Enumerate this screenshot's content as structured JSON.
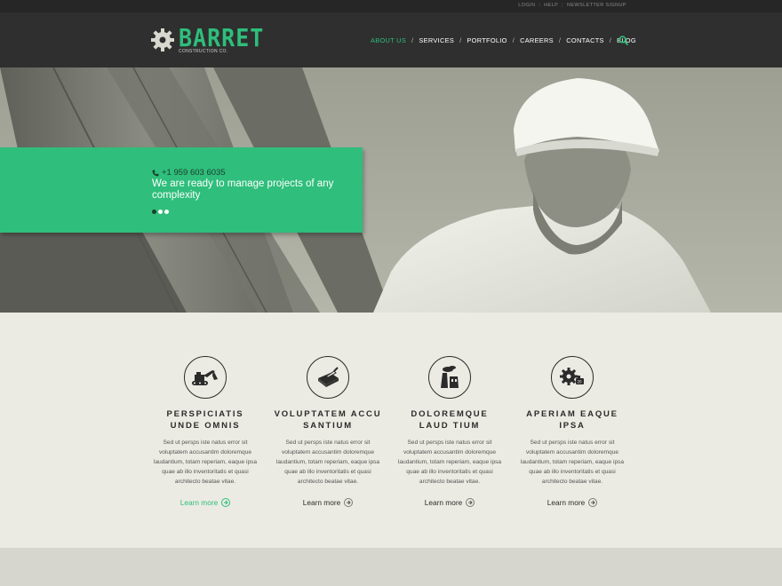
{
  "topbar": {
    "links": [
      "LOGIN",
      "HELP",
      "NEWSLETTER SIGNUP"
    ]
  },
  "logo": {
    "name": "BARRET",
    "subtitle": "CONSTRUCTION CO."
  },
  "nav": {
    "items": [
      "ABOUT US",
      "SERVICES",
      "PORTFOLIO",
      "CAREERS",
      "CONTACTS",
      "BLOG"
    ],
    "active_index": 0,
    "separator": "/"
  },
  "hero": {
    "phone": "+1 959 603 6035",
    "tagline": "We are ready to manage projects of any complexity",
    "slide_count": 3,
    "active_slide": 0
  },
  "features": [
    {
      "icon": "excavator-icon",
      "title": "PERSPICIATIS UNDE OMNIS",
      "text": "Sed ut persps iste natus error sit voluptatem accusantim doloremque laudantium, totam reperiam, eaque ipsa quae ab illo inventoritatis et quasi architecto beatae vitae.",
      "link": "Learn more",
      "highlighted": true
    },
    {
      "icon": "trowel-brick-icon",
      "title": "VOLUPTATEM ACCU SANTIUM",
      "text": "Sed ut persps iste natus error sit voluptatem accusantim doloremque laudantium, totam reperiam, eaque ipsa quae ab illo inventoritatis et quasi architecto beatae vitae.",
      "link": "Learn more",
      "highlighted": false
    },
    {
      "icon": "factory-icon",
      "title": "DOLOREMQUE LAUD TIUM",
      "text": "Sed ut persps iste natus error sit voluptatem accusantim doloremque laudantium, totam reperiam, eaque ipsa quae ab illo inventoritatis et quasi architecto beatae vitae.",
      "link": "Learn more",
      "highlighted": false
    },
    {
      "icon": "gears-icon",
      "title": "APERIAM EAQUE IPSA",
      "text": "Sed ut persps iste natus error sit voluptatem accusantim doloremque laudantium, totam reperiam, eaque ipsa quae ab illo inventoritatis et quasi architecto beatae vitae.",
      "link": "Learn more",
      "highlighted": false
    }
  ],
  "colors": {
    "accent": "#2ebe7b",
    "header_bg": "#2f2f2f",
    "topbar_bg": "#262626",
    "features_bg": "#ebebe3"
  }
}
